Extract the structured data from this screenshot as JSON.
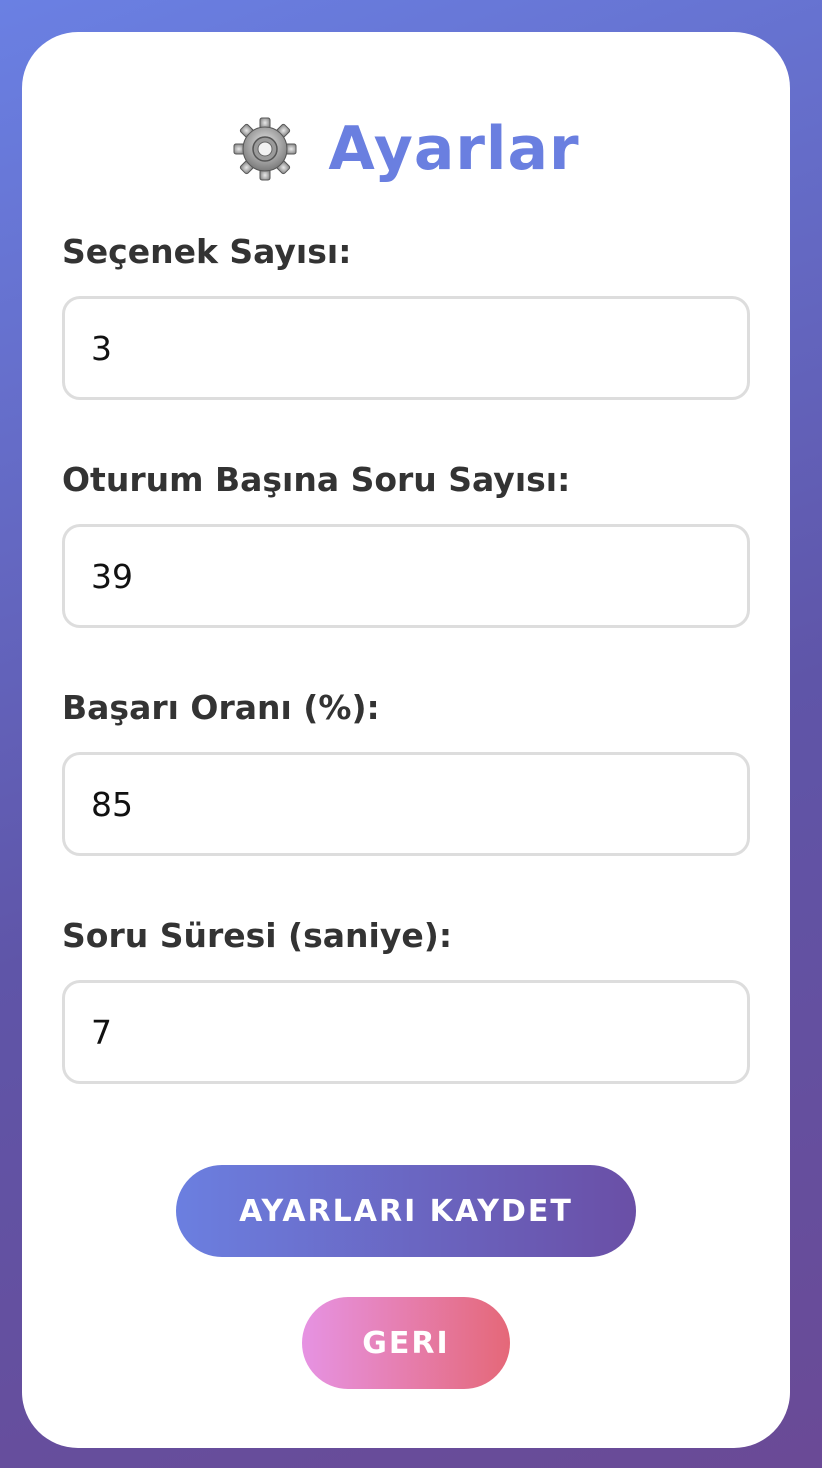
{
  "page": {
    "title": "Ayarlar",
    "icon": "gear-icon"
  },
  "fields": [
    {
      "label": "Seçenek Sayısı:",
      "value": "3"
    },
    {
      "label": "Oturum Başına Soru Sayısı:",
      "value": "39"
    },
    {
      "label": "Başarı Oranı (%):",
      "value": "85"
    },
    {
      "label": "Soru Süresi (saniye):",
      "value": "7"
    }
  ],
  "buttons": {
    "save_label": "AYARLARI KAYDET",
    "back_label": "GERI"
  },
  "colors": {
    "accent": "#6a7fe0",
    "save_gradient_start": "#6b7fe0",
    "save_gradient_end": "#6a4fa6",
    "back_gradient_start": "#e693e3",
    "back_gradient_end": "#e56878"
  }
}
